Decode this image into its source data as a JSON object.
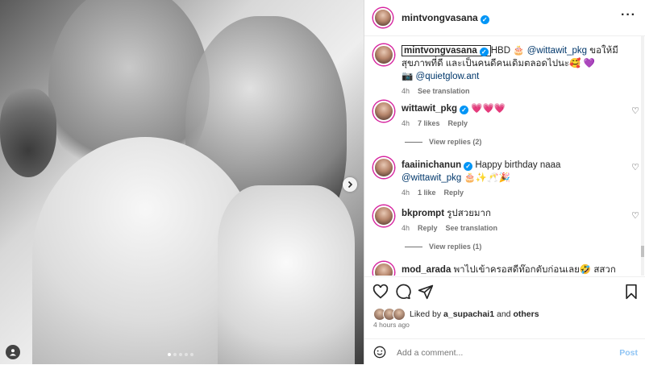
{
  "post": {
    "author": "mintvongvasana",
    "more_icon": "more-horizontal-icon",
    "carousel_total": 5,
    "carousel_active": 1
  },
  "comments": [
    {
      "user": "mintvongvasana",
      "verified": true,
      "text_1": "HBD 🎂",
      "mention": "@wittawit_pkg",
      "text_2": " ขอให้มีสุขภาพที่ดี และเป็นคนดีคนเดิมตลอดไปนะ🥰 💜",
      "line2_prefix": "📷",
      "mention2": "@quietglow.ant",
      "time": "4h",
      "action1": "See translation"
    },
    {
      "user": "wittawit_pkg",
      "verified": true,
      "text": "💗💗💗",
      "time": "4h",
      "likes": "7 likes",
      "reply": "Reply",
      "view_replies": "View replies (2)"
    },
    {
      "user": "faaiinichanun",
      "verified": true,
      "text_1": "Happy birthday naaa ",
      "mention": "@wittawit_pkg",
      "text_2": " 🎂✨🥂🎉",
      "time": "4h",
      "likes": "1 like",
      "reply": "Reply"
    },
    {
      "user": "bkprompt",
      "verified": false,
      "text": "รูปสวยมาก",
      "time": "4h",
      "reply": "Reply",
      "action2": "See translation",
      "view_replies": "View replies (1)"
    },
    {
      "user": "mod_arada",
      "verified": false,
      "text": "พาไปเข้าครอสดีท๊อกตับก่อนเลย🤣 สสวกนะคนดีขอ"
    }
  ],
  "likes": {
    "prefix": "Liked by ",
    "user": "a_supachai1",
    "middle": " and ",
    "others": "others"
  },
  "post_time": "4 hours ago",
  "add_comment": {
    "placeholder": "Add a comment...",
    "post_label": "Post"
  }
}
